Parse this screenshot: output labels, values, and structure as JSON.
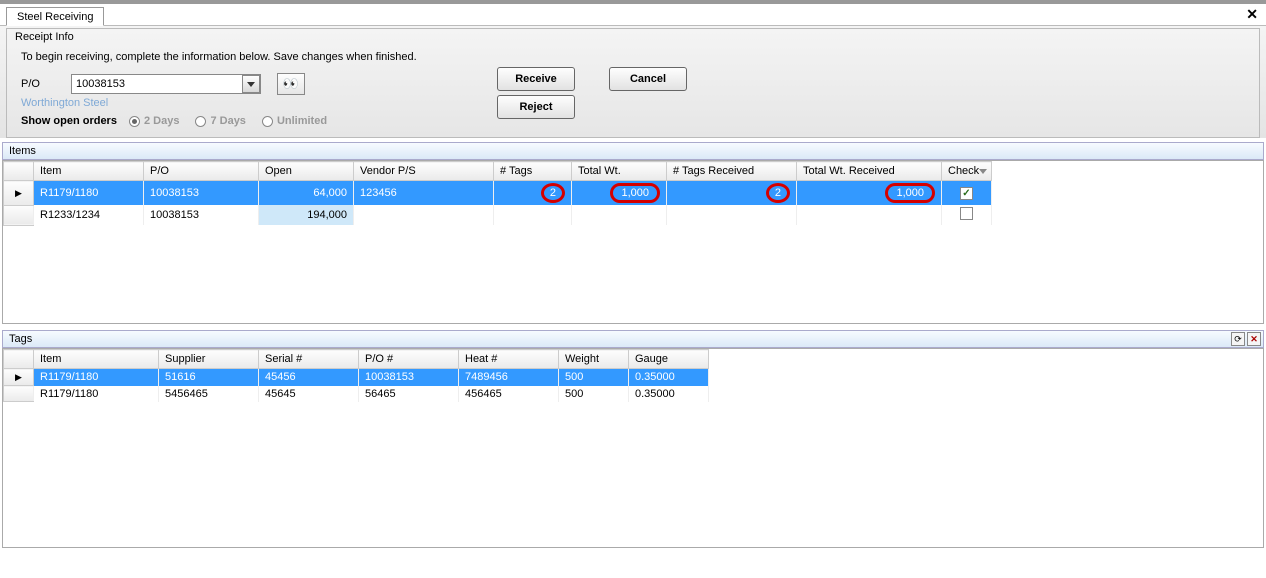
{
  "tab_title": "Steel Receiving",
  "receipt": {
    "title": "Receipt Info",
    "instructions": "To begin receiving, complete the information below.  Save changes when finished.",
    "po_label": "P/O",
    "po_value": "10038153",
    "vendor_name": "Worthington Steel"
  },
  "buttons": {
    "receive": "Receive",
    "cancel": "Cancel",
    "reject": "Reject"
  },
  "show_open": {
    "label": "Show open orders",
    "opt_2": "2 Days",
    "opt_7": "7 Days",
    "opt_unl": "Unlimited"
  },
  "items": {
    "title": "Items",
    "headers": {
      "item": "Item",
      "po": "P/O",
      "open": "Open",
      "vendor_ps": "Vendor P/S",
      "tags": "# Tags",
      "total_wt": "Total Wt.",
      "tags_recv": "# Tags Received",
      "total_wt_recv": "Total Wt. Received",
      "check": "Check"
    },
    "rows": [
      {
        "item": "R1179/1180",
        "po": "10038153",
        "open": "64,000",
        "vps": "123456",
        "tags": "2",
        "twt": "1,000",
        "tagr": "2",
        "twtr": "1,000",
        "checked": true,
        "selected": true
      },
      {
        "item": "R1233/1234",
        "po": "10038153",
        "open": "194,000",
        "vps": "",
        "tags": "",
        "twt": "",
        "tagr": "",
        "twtr": "",
        "checked": false,
        "selected": false
      }
    ]
  },
  "tags": {
    "title": "Tags",
    "headers": {
      "item": "Item",
      "supplier": "Supplier",
      "serial": "Serial #",
      "po": "P/O #",
      "heat": "Heat #",
      "weight": "Weight",
      "gauge": "Gauge"
    },
    "rows": [
      {
        "item": "R1179/1180",
        "supplier": "51616",
        "serial": "45456",
        "po": "10038153",
        "heat": "7489456",
        "weight": "500",
        "gauge": "0.35000",
        "selected": true
      },
      {
        "item": "R1179/1180",
        "supplier": "5456465",
        "serial": "45645",
        "po": "56465",
        "heat": "456465",
        "weight": "500",
        "gauge": "0.35000",
        "selected": false
      }
    ]
  }
}
